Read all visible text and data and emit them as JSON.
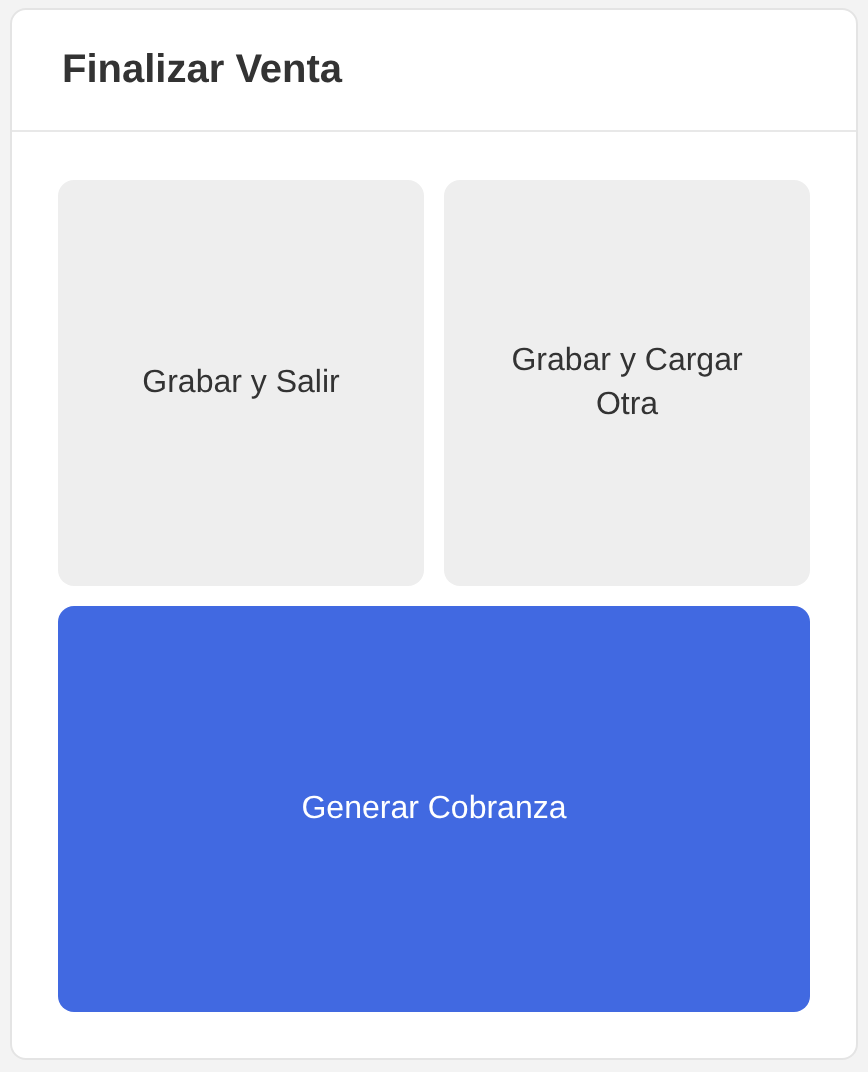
{
  "card": {
    "title": "Finalizar Venta"
  },
  "buttons": [
    {
      "label": "Grabar y Salir",
      "kind": "secondary"
    },
    {
      "label": "Grabar y Cargar Otra",
      "kind": "secondary"
    },
    {
      "label": "Generar Cobranza",
      "kind": "primary"
    }
  ]
}
